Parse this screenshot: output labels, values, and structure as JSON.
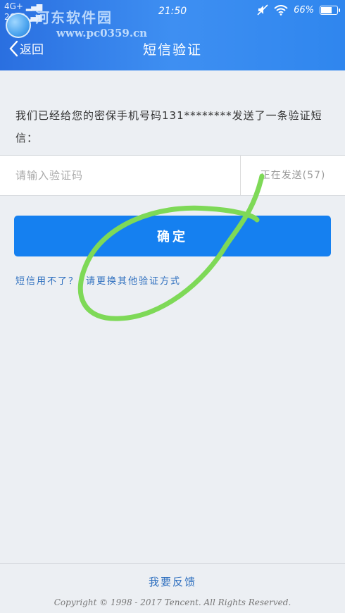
{
  "status_bar": {
    "network_top": "4G+",
    "network_bottom": "2G",
    "carrier_signal": "G",
    "time": "21:50",
    "battery": "66%",
    "battery_level": 0.66
  },
  "watermark": {
    "title": "河东软件园",
    "url": "www.pc0359.cn"
  },
  "nav": {
    "back_label": "返回",
    "title": "短信验证"
  },
  "prompt": {
    "text": "我们已经给您的密保手机号码131********发送了一条验证短信："
  },
  "code_input": {
    "placeholder": "请输入验证码",
    "value": ""
  },
  "resend": {
    "label": "正在发送(57)"
  },
  "confirm": {
    "label": "确定"
  },
  "alt": {
    "prefix": "短信用不了？",
    "action": "请更换其他验证方式"
  },
  "footer": {
    "feedback": "我要反馈",
    "copyright": "Copyright © 1998 - 2017 Tencent. All Rights Reserved."
  },
  "colors": {
    "header_gradient_start": "#2a6fe0",
    "primary_button": "#1580f0",
    "link": "#2e6fbf",
    "annotation_stroke": "#7ed957"
  },
  "icons": {
    "back": "chevron-left-icon",
    "wifi": "wifi-icon",
    "mute": "mute-icon",
    "battery": "battery-icon"
  }
}
